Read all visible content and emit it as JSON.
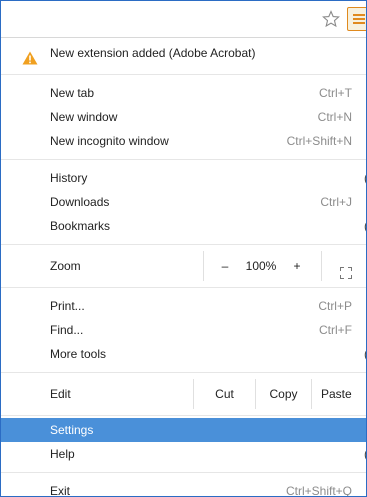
{
  "toolbar": {
    "star_icon": "star-outline-icon",
    "menu_icon": "hamburger-menu-icon",
    "accent_color": "#e08a1e"
  },
  "menu": {
    "notice": {
      "icon": "warning-triangle-icon",
      "label": "New extension added (Adobe Acrobat)",
      "icon_color": "#f0a020"
    },
    "new_tab": {
      "label": "New tab",
      "shortcut": "Ctrl+T"
    },
    "new_window": {
      "label": "New window",
      "shortcut": "Ctrl+N"
    },
    "new_incognito": {
      "label": "New incognito window",
      "shortcut": "Ctrl+Shift+N"
    },
    "history": {
      "label": "History",
      "more": "("
    },
    "downloads": {
      "label": "Downloads",
      "shortcut": "Ctrl+J"
    },
    "bookmarks": {
      "label": "Bookmarks",
      "more": "("
    },
    "zoom": {
      "label": "Zoom",
      "minus": "–",
      "value": "100%",
      "plus": "+",
      "fullscreen_icon": "fullscreen-icon"
    },
    "print": {
      "label": "Print...",
      "shortcut": "Ctrl+P"
    },
    "find": {
      "label": "Find...",
      "shortcut": "Ctrl+F"
    },
    "more_tools": {
      "label": "More tools",
      "more": "("
    },
    "edit": {
      "label": "Edit",
      "cut": "Cut",
      "copy": "Copy",
      "paste": "Paste"
    },
    "settings": {
      "label": "Settings",
      "highlight_color": "#4a90d9"
    },
    "help": {
      "label": "Help",
      "more": "("
    },
    "exit": {
      "label": "Exit",
      "shortcut": "Ctrl+Shift+Q"
    }
  }
}
